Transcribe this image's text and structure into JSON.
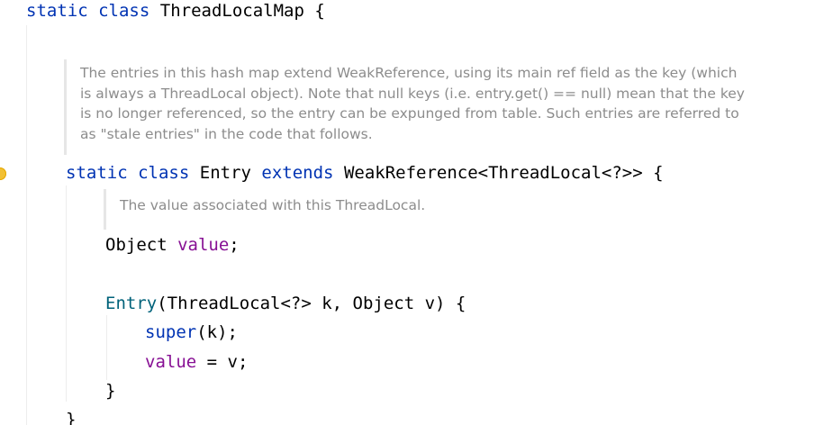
{
  "code": {
    "line1": {
      "kw1": "static",
      "kw2": "class",
      "name": "ThreadLocalMap",
      "brace": "{"
    },
    "doc1": [
      "The entries in this hash map extend WeakReference, using its main ref field as the key (which",
      "is always a ThreadLocal object). Note that null keys (i.e. entry.get() == null) mean that the key",
      "is no longer referenced, so the entry can be expunged from table. Such entries are referred to",
      "as \"stale entries\" in the code that follows."
    ],
    "line2": {
      "kw1": "static",
      "kw2": "class",
      "name": "Entry",
      "kw3": "extends",
      "type": "WeakReference<ThreadLocal<?>>",
      "brace": "{"
    },
    "doc2": [
      "The value associated with this ThreadLocal."
    ],
    "line3": {
      "type": "Object",
      "field": "value",
      "semi": ";"
    },
    "line4": {
      "ctor": "Entry",
      "params": "(ThreadLocal<?> k, Object v) {"
    },
    "line5": {
      "kw": "super",
      "rest": "(k);"
    },
    "line6": {
      "field": "value",
      "rest": " = v;"
    },
    "line7": {
      "brace": "}"
    },
    "line8": {
      "brace": "}"
    }
  },
  "icons": {
    "gutter": "lightbulb-icon"
  },
  "colors": {
    "keyword": "#0033b3",
    "field": "#871094",
    "doc": "#8c8c8c",
    "function": "#00627a"
  }
}
